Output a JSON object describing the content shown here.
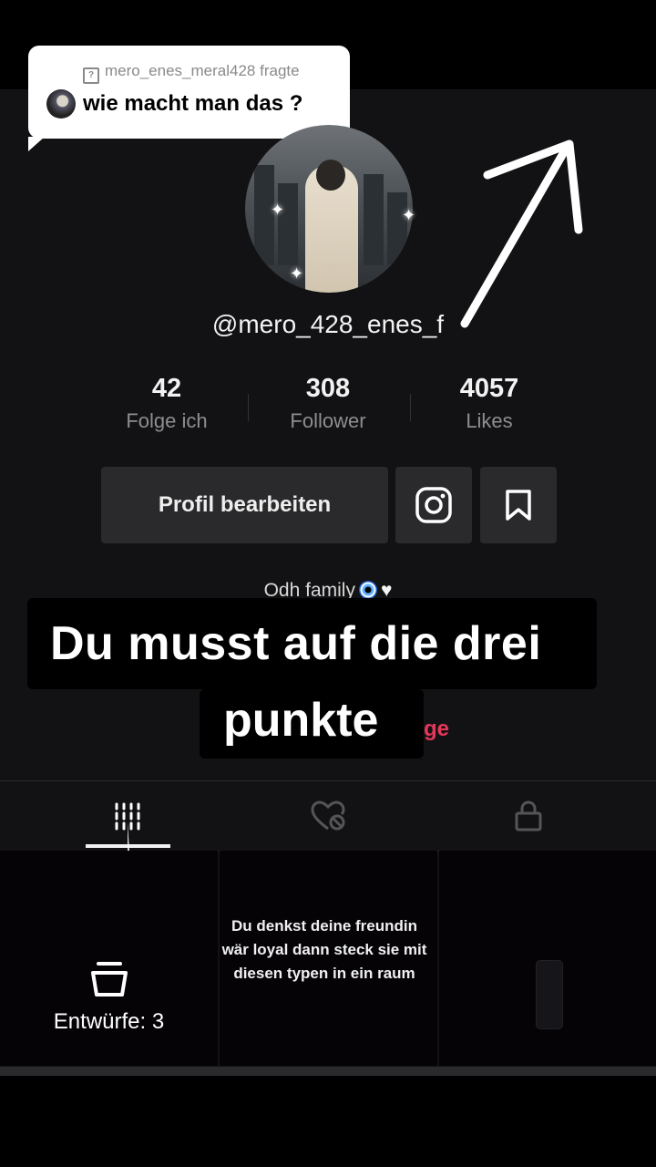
{
  "question": {
    "asker": "mero_enes_meral428 fragte",
    "text": "wie macht man das ?"
  },
  "profile": {
    "username": "@mero_428_enes_f",
    "stats": [
      {
        "value": "42",
        "label": "Folge ich"
      },
      {
        "value": "308",
        "label": "Follower"
      },
      {
        "value": "4057",
        "label": "Likes"
      }
    ],
    "edit_button": "Profil bearbeiten",
    "bio": "Odh family"
  },
  "captions": {
    "line1": "Du musst auf die drei",
    "line2": "punkte",
    "partial_link": "ge"
  },
  "tabs": [
    {
      "icon": "grid-icon",
      "active": true
    },
    {
      "icon": "liked-hidden-icon",
      "active": false
    },
    {
      "icon": "lock-icon",
      "active": false
    }
  ],
  "grid": {
    "drafts_label": "Entwürfe: 3",
    "video_text": "Du denkst deine freundin wär loyal dann steck sie mit diesen typen in ein raum"
  },
  "colors": {
    "background": "#121214",
    "button": "#2a2a2c",
    "accent_red": "#e6375a"
  }
}
